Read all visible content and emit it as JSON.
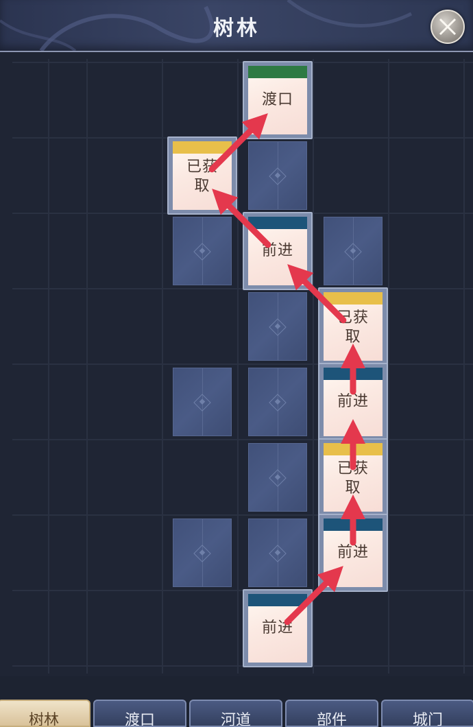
{
  "header": {
    "title": "树林"
  },
  "board": {
    "cells": [
      {
        "row": 0,
        "col": 3,
        "state": "revealed",
        "label": "渡口",
        "band": "green"
      },
      {
        "row": 1,
        "col": 2,
        "state": "revealed",
        "label": "已获取",
        "band": "yellow"
      },
      {
        "row": 1,
        "col": 3,
        "state": "hidden"
      },
      {
        "row": 2,
        "col": 2,
        "state": "hidden"
      },
      {
        "row": 2,
        "col": 3,
        "state": "revealed",
        "label": "前进",
        "band": "blue"
      },
      {
        "row": 2,
        "col": 4,
        "state": "hidden"
      },
      {
        "row": 3,
        "col": 3,
        "state": "hidden"
      },
      {
        "row": 3,
        "col": 4,
        "state": "revealed",
        "label": "已获取",
        "band": "yellow"
      },
      {
        "row": 4,
        "col": 2,
        "state": "hidden"
      },
      {
        "row": 4,
        "col": 3,
        "state": "hidden"
      },
      {
        "row": 4,
        "col": 4,
        "state": "revealed",
        "label": "前进",
        "band": "blue"
      },
      {
        "row": 5,
        "col": 3,
        "state": "hidden"
      },
      {
        "row": 5,
        "col": 4,
        "state": "revealed",
        "label": "已获取",
        "band": "yellow"
      },
      {
        "row": 6,
        "col": 2,
        "state": "hidden"
      },
      {
        "row": 6,
        "col": 3,
        "state": "hidden"
      },
      {
        "row": 6,
        "col": 4,
        "state": "revealed",
        "label": "前进",
        "band": "blue"
      },
      {
        "row": 7,
        "col": 3,
        "state": "revealed",
        "label": "前进",
        "band": "blue"
      }
    ],
    "path": [
      {
        "row": 7,
        "col": 3
      },
      {
        "row": 6,
        "col": 4
      },
      {
        "row": 5,
        "col": 4
      },
      {
        "row": 4,
        "col": 4
      },
      {
        "row": 3,
        "col": 4
      },
      {
        "row": 2,
        "col": 3
      },
      {
        "row": 1,
        "col": 2
      },
      {
        "row": 0,
        "col": 3
      }
    ]
  },
  "tabs": [
    {
      "label": "树林",
      "active": true
    },
    {
      "label": "渡口",
      "active": false
    },
    {
      "label": "河道",
      "active": false
    },
    {
      "label": "部件",
      "active": false
    },
    {
      "label": "城门",
      "active": false
    }
  ],
  "colors": {
    "green": "#2e7a43",
    "yellow": "#e8bf4a",
    "blue": "#1d5479",
    "arrow": "#e4384d"
  }
}
